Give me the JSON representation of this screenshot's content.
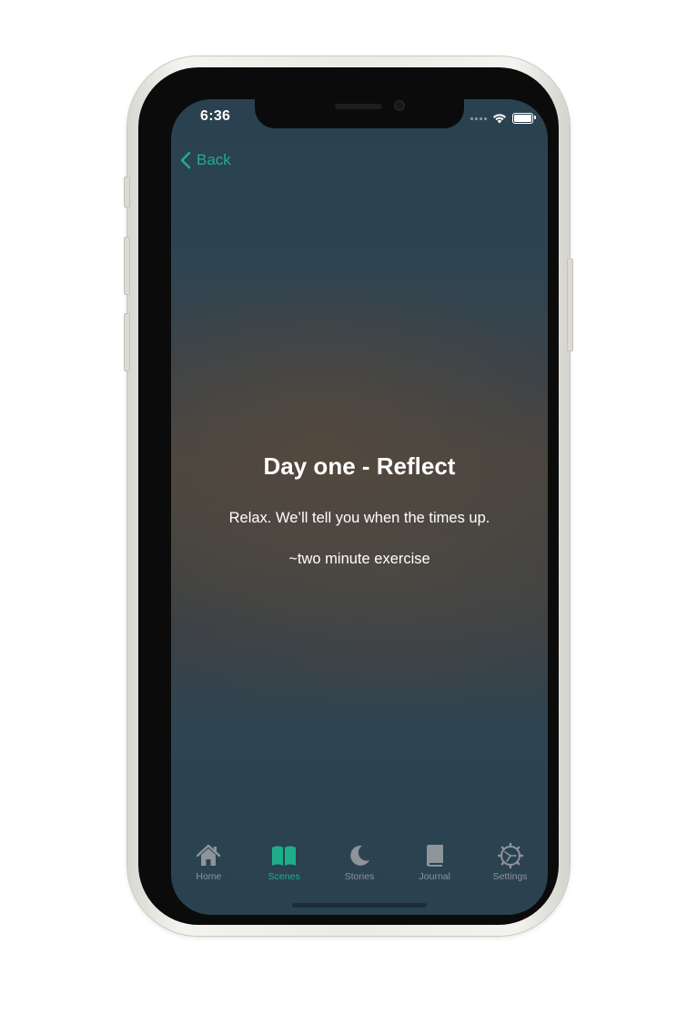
{
  "status_bar": {
    "time": "6:36"
  },
  "nav": {
    "back_label": "Back"
  },
  "main": {
    "title": "Day one - Reflect",
    "subtitle": "Relax. We’ll tell you when the times up.",
    "duration": "~two minute exercise"
  },
  "tabbar": {
    "items": [
      {
        "label": "Home",
        "icon": "house-icon"
      },
      {
        "label": "Scenes",
        "icon": "book-open-icon",
        "active": true
      },
      {
        "label": "Stories",
        "icon": "moon-icon"
      },
      {
        "label": "Journal",
        "icon": "book-icon"
      },
      {
        "label": "Settings",
        "icon": "gear-icon"
      }
    ]
  },
  "colors": {
    "accent": "#1fae8c",
    "tab_inactive": "#8d949a",
    "text": "#ffffff"
  }
}
